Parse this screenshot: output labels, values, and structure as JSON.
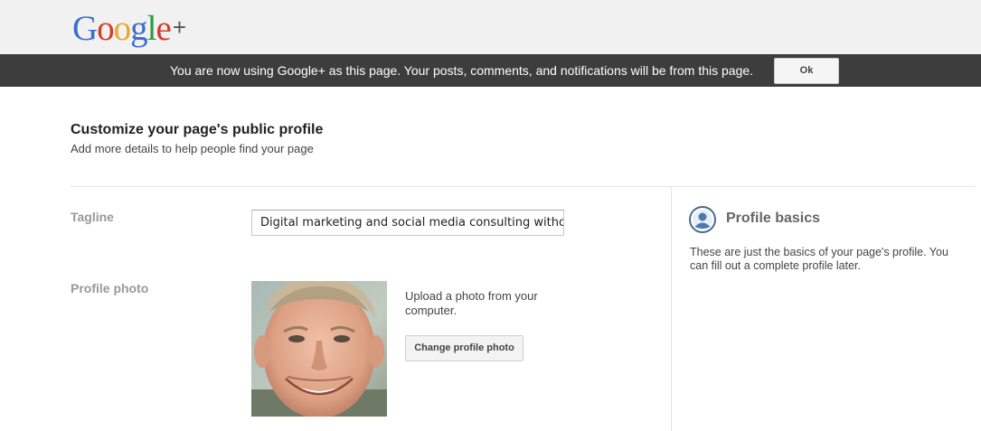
{
  "header": {
    "logo_letters": [
      {
        "char": "G",
        "color": "#3a6fd0"
      },
      {
        "char": "o",
        "color": "#d93a2b"
      },
      {
        "char": "o",
        "color": "#e7a826"
      },
      {
        "char": "g",
        "color": "#3a6fd0"
      },
      {
        "char": "l",
        "color": "#2e9a43"
      },
      {
        "char": "e",
        "color": "#d93a2b"
      }
    ],
    "logo_plus": "+"
  },
  "notice": {
    "text": "You are now using Google+ as this page. Your posts, comments, and notifications will be from this page.",
    "ok_label": "Ok"
  },
  "main": {
    "title": "Customize your page's public profile",
    "subtitle": "Add more details to help people find your page",
    "tagline_label": "Tagline",
    "tagline_value": "Digital marketing and social media consulting witho",
    "photo_label": "Profile photo",
    "upload_text": "Upload a photo from your computer.",
    "change_photo_label": "Change profile photo"
  },
  "sidebar": {
    "icon": "profile-icon",
    "title": "Profile basics",
    "text": "These are just the basics of your page's profile. You can fill out a complete profile later."
  }
}
